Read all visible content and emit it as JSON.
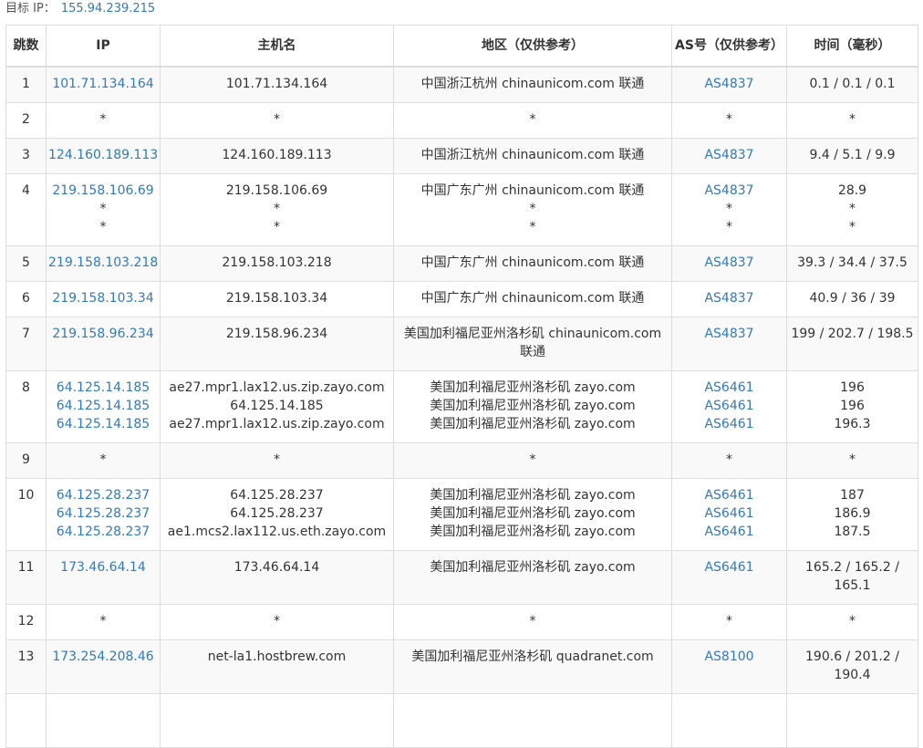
{
  "target": {
    "label": "目标 IP：",
    "ip": "155.94.239.215"
  },
  "headers": {
    "hop": "跳数",
    "ip": "IP",
    "host": "主机名",
    "region": "地区（仅供参考）",
    "asn": "AS号（仅供参考）",
    "time": "时间（毫秒）"
  },
  "rows": [
    {
      "hop": "1",
      "ip": [
        "101.71.134.164"
      ],
      "host": [
        "101.71.134.164"
      ],
      "region": [
        "中国浙江杭州 chinaunicom.com 联通"
      ],
      "asn": [
        "AS4837"
      ],
      "time": [
        "0.1 / 0.1 / 0.1"
      ]
    },
    {
      "hop": "2",
      "ip": [
        "*"
      ],
      "host": [
        "*"
      ],
      "region": [
        "*"
      ],
      "asn": [
        "*"
      ],
      "time": [
        "*"
      ]
    },
    {
      "hop": "3",
      "ip": [
        "124.160.189.113"
      ],
      "host": [
        "124.160.189.113"
      ],
      "region": [
        "中国浙江杭州 chinaunicom.com 联通"
      ],
      "asn": [
        "AS4837"
      ],
      "time": [
        "9.4 / 5.1 / 9.9"
      ]
    },
    {
      "hop": "4",
      "ip": [
        "219.158.106.69",
        "*",
        "*"
      ],
      "host": [
        "219.158.106.69",
        "*",
        "*"
      ],
      "region": [
        "中国广东广州 chinaunicom.com 联通",
        "*",
        "*"
      ],
      "asn": [
        "AS4837",
        "*",
        "*"
      ],
      "time": [
        "28.9",
        "*",
        "*"
      ]
    },
    {
      "hop": "5",
      "ip": [
        "219.158.103.218"
      ],
      "host": [
        "219.158.103.218"
      ],
      "region": [
        "中国广东广州 chinaunicom.com 联通"
      ],
      "asn": [
        "AS4837"
      ],
      "time": [
        "39.3 / 34.4 / 37.5"
      ]
    },
    {
      "hop": "6",
      "ip": [
        "219.158.103.34"
      ],
      "host": [
        "219.158.103.34"
      ],
      "region": [
        "中国广东广州 chinaunicom.com 联通"
      ],
      "asn": [
        "AS4837"
      ],
      "time": [
        "40.9 / 36 / 39"
      ]
    },
    {
      "hop": "7",
      "ip": [
        "219.158.96.234"
      ],
      "host": [
        "219.158.96.234"
      ],
      "region": [
        "美国加利福尼亚州洛杉矶 chinaunicom.com 联通"
      ],
      "asn": [
        "AS4837"
      ],
      "time": [
        "199 / 202.7 / 198.5"
      ]
    },
    {
      "hop": "8",
      "ip": [
        "64.125.14.185",
        "64.125.14.185",
        "64.125.14.185"
      ],
      "host": [
        "ae27.mpr1.lax12.us.zip.zayo.com",
        "64.125.14.185",
        "ae27.mpr1.lax12.us.zip.zayo.com"
      ],
      "region": [
        "美国加利福尼亚州洛杉矶 zayo.com",
        "美国加利福尼亚州洛杉矶 zayo.com",
        "美国加利福尼亚州洛杉矶 zayo.com"
      ],
      "asn": [
        "AS6461",
        "AS6461",
        "AS6461"
      ],
      "time": [
        "196",
        "196",
        "196.3"
      ]
    },
    {
      "hop": "9",
      "ip": [
        "*"
      ],
      "host": [
        "*"
      ],
      "region": [
        "*"
      ],
      "asn": [
        "*"
      ],
      "time": [
        "*"
      ]
    },
    {
      "hop": "10",
      "ip": [
        "64.125.28.237",
        "64.125.28.237",
        "64.125.28.237"
      ],
      "host": [
        "64.125.28.237",
        "64.125.28.237",
        "ae1.mcs2.lax112.us.eth.zayo.com"
      ],
      "region": [
        "美国加利福尼亚州洛杉矶 zayo.com",
        "美国加利福尼亚州洛杉矶 zayo.com",
        "美国加利福尼亚州洛杉矶 zayo.com"
      ],
      "asn": [
        "AS6461",
        "AS6461",
        "AS6461"
      ],
      "time": [
        "187",
        "186.9",
        "187.5"
      ]
    },
    {
      "hop": "11",
      "ip": [
        "173.46.64.14"
      ],
      "host": [
        "173.46.64.14"
      ],
      "region": [
        "美国加利福尼亚州洛杉矶 zayo.com"
      ],
      "asn": [
        "AS6461"
      ],
      "time": [
        "165.2 / 165.2 / 165.1"
      ]
    },
    {
      "hop": "12",
      "ip": [
        "*"
      ],
      "host": [
        "*"
      ],
      "region": [
        "*"
      ],
      "asn": [
        "*"
      ],
      "time": [
        "*"
      ]
    },
    {
      "hop": "13",
      "ip": [
        "173.254.208.46"
      ],
      "host": [
        "net-la1.hostbrew.com"
      ],
      "region": [
        "美国加利福尼亚州洛杉矶 quadranet.com"
      ],
      "asn": [
        "AS8100"
      ],
      "time": [
        "190.6 / 201.2 / 190.4"
      ]
    },
    {
      "hop": "",
      "ip": [
        ""
      ],
      "host": [
        ""
      ],
      "region": [
        ""
      ],
      "asn": [
        ""
      ],
      "time": [
        ""
      ]
    }
  ]
}
